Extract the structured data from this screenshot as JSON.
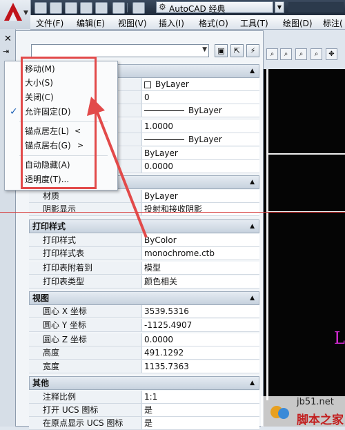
{
  "app": {
    "workspace": "AutoCAD 经典"
  },
  "menubar": [
    "文件(F)",
    "编辑(E)",
    "视图(V)",
    "插入(I)",
    "格式(O)",
    "工具(T)",
    "绘图(D)",
    "标注("
  ],
  "context_menu": {
    "items": [
      {
        "label": "移动(M)"
      },
      {
        "label": "大小(S)"
      },
      {
        "label": "关闭(C)"
      },
      {
        "label": "允许固定(D)",
        "checked": true
      },
      {
        "label": "锚点居左(L)",
        "submenu": "<"
      },
      {
        "label": "锚点居右(G)",
        "submenu": ">"
      },
      {
        "label": "自动隐藏(A)"
      },
      {
        "label": "透明度(T)..."
      }
    ]
  },
  "properties": {
    "general_rows": [
      {
        "label": "",
        "value": "ByLayer",
        "kind": "swatch"
      },
      {
        "label": "",
        "value": "0"
      },
      {
        "label": "",
        "value": "ByLayer",
        "kind": "line"
      },
      {
        "label": "",
        "value": "1.0000"
      },
      {
        "label": "",
        "value": "ByLayer",
        "kind": "line"
      },
      {
        "label": "",
        "value": "ByLayer"
      },
      {
        "label": "",
        "value": "0.0000"
      }
    ],
    "section_3d": {
      "rows": [
        {
          "label": "材质",
          "value": "ByLayer"
        },
        {
          "label": "阴影显示",
          "value": "投射和接收阴影"
        }
      ]
    },
    "section_plot": {
      "title": "打印样式",
      "rows": [
        {
          "label": "打印样式",
          "value": "ByColor"
        },
        {
          "label": "打印样式表",
          "value": "monochrome.ctb"
        },
        {
          "label": "打印表附着到",
          "value": "模型"
        },
        {
          "label": "打印表类型",
          "value": "颜色相关"
        }
      ]
    },
    "section_view": {
      "title": "视图",
      "rows": [
        {
          "label": "圆心 X 坐标",
          "value": "3539.5316"
        },
        {
          "label": "圆心 Y 坐标",
          "value": "-1125.4907"
        },
        {
          "label": "圆心 Z 坐标",
          "value": "0.0000"
        },
        {
          "label": "高度",
          "value": "491.1292"
        },
        {
          "label": "宽度",
          "value": "1135.7363"
        }
      ]
    },
    "section_misc": {
      "title": "其他",
      "rows": [
        {
          "label": "注释比例",
          "value": "1:1"
        },
        {
          "label": "打开 UCS 图标",
          "value": "是"
        },
        {
          "label": "在原点显示 UCS 图标",
          "value": "是"
        }
      ]
    }
  },
  "canvas": {
    "text": "L"
  },
  "watermark": {
    "site": "jb51.net",
    "name": "脚本之家"
  },
  "colors": {
    "annotation_red": "#e24a4a",
    "autocad_red": "#c0141b"
  }
}
